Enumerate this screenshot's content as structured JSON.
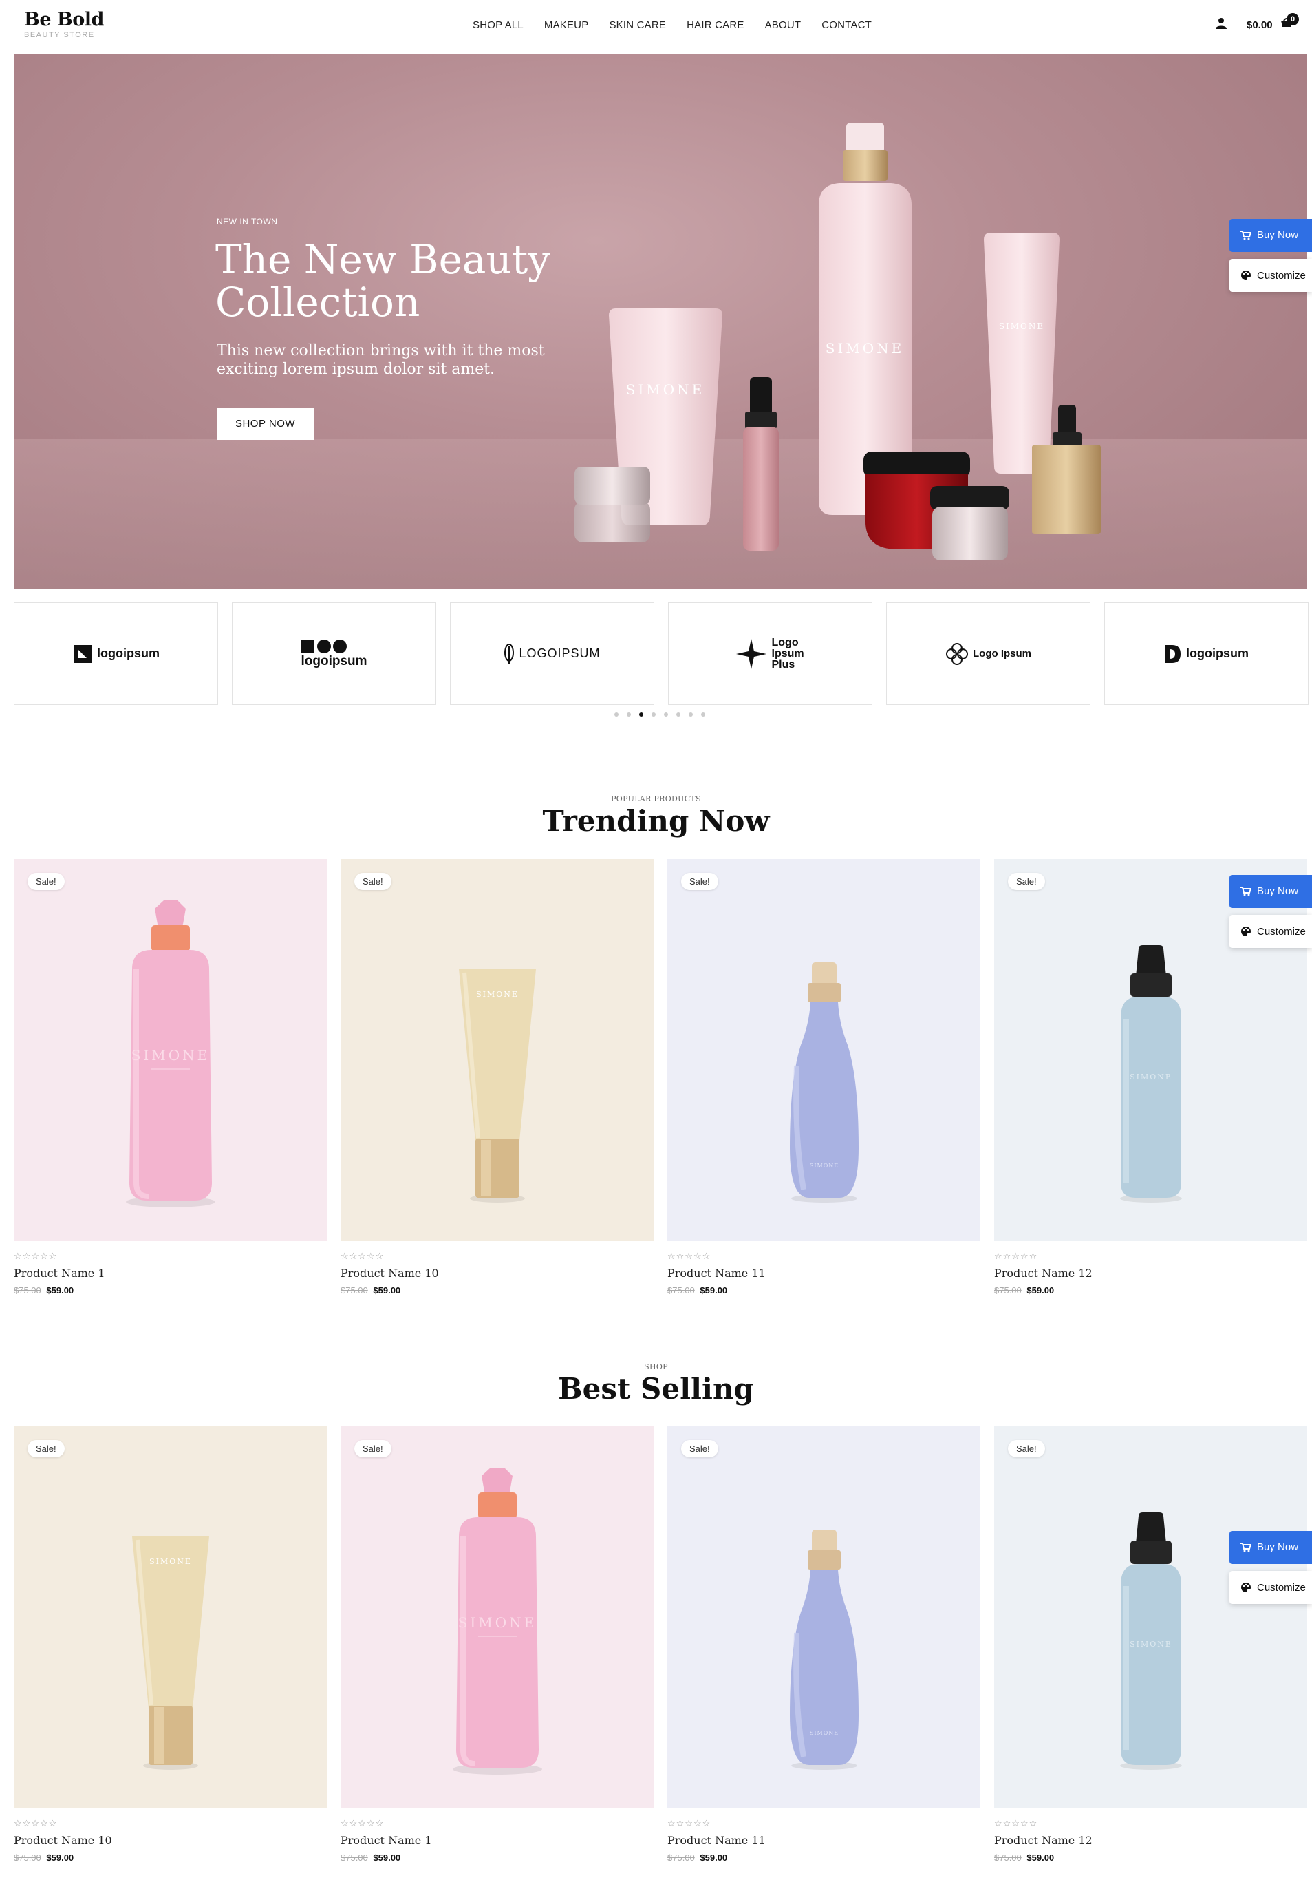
{
  "header": {
    "logo": "Be Bold",
    "logo_sub": "BEAUTY STORE",
    "nav": [
      "SHOP ALL",
      "MAKEUP",
      "SKIN CARE",
      "HAIR CARE",
      "ABOUT",
      "CONTACT"
    ],
    "cart_total": "$0.00",
    "cart_count": "0"
  },
  "hero": {
    "kicker": "NEW IN TOWN",
    "title": "The New Beauty Collection",
    "description": "This new collection brings with it the most exciting lorem ipsum dolor sit amet.",
    "button": "SHOP NOW",
    "brand_on_products": "SIMONE"
  },
  "floating": {
    "buy_now": "Buy Now",
    "customize": "Customize"
  },
  "brand_logos": [
    {
      "text": "logoipsum",
      "icon": "square-logo-icon"
    },
    {
      "text": "logoipsum",
      "icon": "shapes-logo-icon"
    },
    {
      "text": "LOGOIPSUM",
      "icon": "leaf-logo-icon"
    },
    {
      "text": "Logo Ipsum Plus",
      "icon": "cross-logo-icon"
    },
    {
      "text": "Logo Ipsum",
      "icon": "flower-logo-icon"
    },
    {
      "text": "logoipsum",
      "icon": "d-logo-icon"
    }
  ],
  "carousel": {
    "dot_count": 8,
    "active_dot": 2
  },
  "trending": {
    "kicker": "POPULAR PRODUCTS",
    "title": "Trending Now",
    "products": [
      {
        "name": "Product Name 1",
        "old_price": "$75.00",
        "price": "$59.00",
        "badge": "Sale!",
        "bg": "#f7e9ef",
        "type": "pump"
      },
      {
        "name": "Product Name 10",
        "old_price": "$75.00",
        "price": "$59.00",
        "badge": "Sale!",
        "bg": "#f3ece0",
        "type": "tube"
      },
      {
        "name": "Product Name 11",
        "old_price": "$75.00",
        "price": "$59.00",
        "badge": "Sale!",
        "bg": "#edeef7",
        "type": "spray"
      },
      {
        "name": "Product Name 12",
        "old_price": "$75.00",
        "price": "$59.00",
        "badge": "Sale!",
        "bg": "#edf1f5",
        "type": "dropper"
      }
    ]
  },
  "best_selling": {
    "kicker": "SHOP",
    "title": "Best Selling",
    "products": [
      {
        "name": "Product Name 10",
        "old_price": "$75.00",
        "price": "$59.00",
        "badge": "Sale!",
        "bg": "#f3ece0",
        "type": "tube"
      },
      {
        "name": "Product Name 1",
        "old_price": "$75.00",
        "price": "$59.00",
        "badge": "Sale!",
        "bg": "#f7e9ef",
        "type": "pump"
      },
      {
        "name": "Product Name 11",
        "old_price": "$75.00",
        "price": "$59.00",
        "badge": "Sale!",
        "bg": "#edeef7",
        "type": "spray"
      },
      {
        "name": "Product Name 12",
        "old_price": "$75.00",
        "price": "$59.00",
        "badge": "Sale!",
        "bg": "#edf1f5",
        "type": "dropper"
      }
    ]
  },
  "rating_stars": "☆☆☆☆☆",
  "colors": {
    "accent_blue": "#2f6fe4",
    "hero_bg": "#b68d93"
  }
}
